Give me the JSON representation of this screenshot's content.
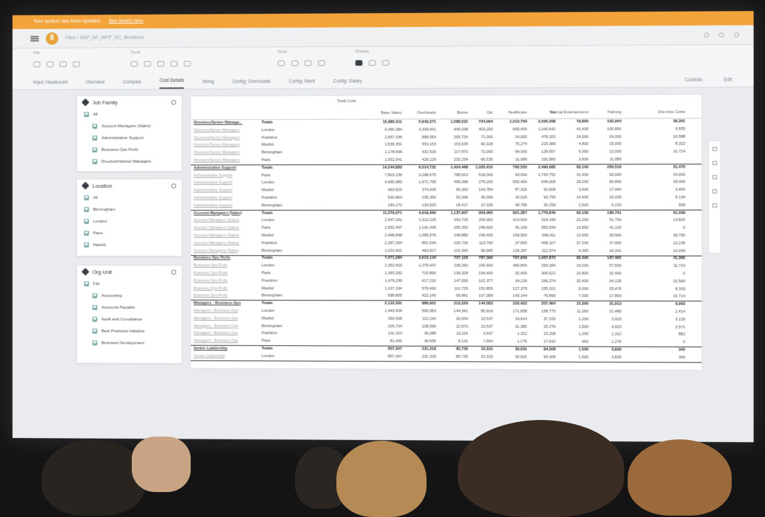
{
  "notice": {
    "text": "Your system has been updated.",
    "link": "See what's new."
  },
  "shell": {
    "logo": "8",
    "breadcrumb": "Files / SAP_SF_WFP_SC_Breakout"
  },
  "toolbar": {
    "file_label": "File",
    "tools_label": "Tools",
    "data_label": "Data",
    "display_label": "Display"
  },
  "tabs": [
    {
      "label": "Input: Headcount"
    },
    {
      "label": "Overview"
    },
    {
      "label": "Compare"
    },
    {
      "label": "Cost Details"
    },
    {
      "label": "Hiring"
    },
    {
      "label": "Config: Overheads"
    },
    {
      "label": "Config: Merit"
    },
    {
      "label": "Config: Salary"
    }
  ],
  "tabs_right": {
    "controls": "Controls",
    "edit": "Edit"
  },
  "filters": {
    "job_family": {
      "title": "Job Family",
      "items": [
        "All",
        "Account Managers (Sales)",
        "Administrative Support",
        "Business Ops Profs",
        "Directors/Senior Managers"
      ]
    },
    "location": {
      "title": "Location",
      "items": [
        "All",
        "Birmingham",
        "London",
        "Paris",
        "Madrid"
      ]
    },
    "org_unit": {
      "title": "Org Unit",
      "items": [
        "F&I",
        "Accounting",
        "Accounts Payable",
        "Audit and Compliance",
        "Best Practices Initiative",
        "Business Development"
      ]
    }
  },
  "grid": {
    "total_cost": "Total Cost",
    "columns": [
      "Base Salary",
      "Overheads",
      "Bonus",
      "Car",
      "Healthcare",
      "Tax",
      "Internal Entertainment",
      "Training",
      "One-time Costs"
    ],
    "rows": [
      {
        "d1": "Directors/Senior Manage...",
        "d2": "Totals",
        "v": [
          "15,885,311",
          "5,643,371",
          "1,588,531",
          "704,064",
          "1,012,764",
          "2,095,268",
          "79,800",
          "162,944",
          "39,391"
        ],
        "t": true
      },
      {
        "d1": "Directors/Senior Managers",
        "d2": "London",
        "v": [
          "9,460,384",
          "3,339,401",
          "946,038",
          "403,200",
          "606,400",
          "1,040,642",
          "42,400",
          "100,800",
          "9,655"
        ]
      },
      {
        "d1": "Directors/Senior Managers",
        "d2": "Frankfurt",
        "v": [
          "2,657,336",
          "888,054",
          "265,734",
          "72,000",
          "24,000",
          "478,320",
          "24,000",
          "24,000",
          "10,588"
        ]
      },
      {
        "d1": "Directors/Senior Managers",
        "d2": "Madrid",
        "v": [
          "1,536,351",
          "554,153",
          "153,635",
          "90,329",
          "75,274",
          "215,089",
          "4,800",
          "15,055",
          "8,322"
        ]
      },
      {
        "d1": "Directors/Senior Managers",
        "d2": "Birmingham",
        "v": [
          "1,178,696",
          "432,526",
          "117,870",
          "72,000",
          "94,000",
          "129,657",
          "5,000",
          "12,000",
          "10,714"
        ]
      },
      {
        "d1": "Directors/Senior Managers",
        "d2": "Paris",
        "v": [
          "1,052,541",
          "429,128",
          "105,254",
          "66,535",
          "11,089",
          "231,560",
          "3,600",
          "11,089",
          ""
        ],
        "e": true
      },
      {
        "d1": "Administrative Support",
        "d2": "Totals",
        "v": [
          "14,244,883",
          "6,014,731",
          "1,424,468",
          "1,020,410",
          "795,535",
          "2,490,682",
          "83,100",
          "200,518",
          "31,470"
        ],
        "t": true
      },
      {
        "d1": "Administrative Support",
        "d2": "Paris",
        "v": [
          "7,803,235",
          "3,298,475",
          "788,523",
          "518,000",
          "93,000",
          "1,734,752",
          "31,400",
          "93,000",
          "24,000"
        ]
      },
      {
        "d1": "Administrative Support",
        "d2": "London",
        "v": [
          "4,990,983",
          "1,971,706",
          "499,098",
          "275,200",
          "550,400",
          "549,008",
          "29,200",
          "66,800",
          "18,000"
        ]
      },
      {
        "d1": "Administrative Support",
        "d2": "Madrid",
        "v": [
          "663,629",
          "374,439",
          "66,363",
          "104,784",
          "87,320",
          "92,908",
          "3,600",
          "17,464",
          "3,400"
        ]
      },
      {
        "d1": "Administrative Support",
        "d2": "Frankfurt",
        "v": [
          "520,664",
          "235,356",
          "52,066",
          "45,066",
          "15,029",
          "93,755",
          "14,400",
          "15,029",
          "5,134"
        ]
      },
      {
        "d1": "Administrative Support",
        "d2": "Birmingham",
        "v": [
          "184,172",
          "134,525",
          "18,417",
          "27,329",
          "49,786",
          "20,259",
          "2,500",
          "6,223",
          "936"
        ],
        "e": true
      },
      {
        "d1": "Account Managers (Sales)",
        "d2": "Totals",
        "v": [
          "11,379,071",
          "4,919,460",
          "1,137,907",
          "903,465",
          "821,387",
          "1,776,840",
          "93,100",
          "186,741",
          "61,099"
        ],
        "t": true
      },
      {
        "d1": "Account Managers (Sales)",
        "d2": "London",
        "v": [
          "2,947,261",
          "1,313,225",
          "294,726",
          "206,000",
          "413,600",
          "324,199",
          "22,200",
          "51,700",
          "14,820"
        ]
      },
      {
        "d1": "Account Managers (Sales)",
        "d2": "Paris",
        "v": [
          "2,652,497",
          "1,191,499",
          "265,250",
          "246,600",
          "41,100",
          "583,549",
          "13,900",
          "41,100",
          "0"
        ]
      },
      {
        "d1": "Account Managers (Sales)",
        "d2": "Madrid",
        "v": [
          "2,468,848",
          "1,089,576",
          "248,885",
          "239,400",
          "199,500",
          "348,411",
          "13,500",
          "39,900",
          "18,750"
        ]
      },
      {
        "d1": "Account Managers (Sales)",
        "d2": "Frankfurt",
        "v": [
          "2,267,264",
          "861,534",
          "226,726",
          "113,700",
          "37,900",
          "408,107",
          "37,200",
          "37,900",
          "13,235"
        ]
      },
      {
        "d1": "Account Managers (Sales)",
        "d2": "Birmingham",
        "v": [
          "1,023,401",
          "463,627",
          "102,340",
          "96,965",
          "129,287",
          "112,574",
          "6,300",
          "16,161",
          "14,294"
        ],
        "e": true
      },
      {
        "d1": "Business Ops Profs",
        "d2": "Totals",
        "v": [
          "7,071,284",
          "3,610,134",
          "707,128",
          "787,390",
          "797,849",
          "1,067,872",
          "82,400",
          "167,495",
          "41,360"
        ],
        "t": true
      },
      {
        "d1": "Business Ops Profs",
        "d2": "London",
        "v": [
          "2,392,603",
          "1,275,447",
          "239,260",
          "230,400",
          "460,800",
          "263,184",
          "24,200",
          "57,600",
          "11,724"
        ]
      },
      {
        "d1": "Business Ops Profs",
        "d2": "Paris",
        "v": [
          "1,393,282",
          "715,850",
          "139,328",
          "194,400",
          "32,400",
          "306,522",
          "10,800",
          "32,400",
          "0"
        ]
      },
      {
        "d1": "Business Ops Profs",
        "d2": "Frankfurt",
        "v": [
          "1,479,299",
          "617,232",
          "147,930",
          "102,377",
          "34,126",
          "266,274",
          "32,400",
          "34,126",
          "10,560"
        ]
      },
      {
        "d1": "Business Ops Profs",
        "d2": "Madrid",
        "v": [
          "1,107,294",
          "579,460",
          "110,729",
          "152,855",
          "127,379",
          "155,021",
          "8,000",
          "25,476",
          "8,333"
        ]
      },
      {
        "d1": "Business Ops Profs",
        "d2": "Birmingham",
        "v": [
          "698,805",
          "422,145",
          "69,881",
          "107,358",
          "143,144",
          "76,869",
          "7,000",
          "17,893",
          "10,714"
        ],
        "e": true
      },
      {
        "d1": "Managers - Business Ops",
        "d2": "Totals",
        "v": [
          "2,122,291",
          "886,931",
          "212,229",
          "144,583",
          "225,422",
          "257,464",
          "15,300",
          "31,913",
          "9,993"
        ],
        "t": true
      },
      {
        "d1": "Managers - Business Ops",
        "d2": "London",
        "v": [
          "1,443,409",
          "595,353",
          "144,341",
          "85,919",
          "171,838",
          "158,775",
          "11,000",
          "21,480",
          "2,414"
        ]
      },
      {
        "d1": "Managers - Business Ops",
        "d2": "Madrid",
        "v": [
          "266,538",
          "112,242",
          "26,654",
          "23,537",
          "19,614",
          "37,315",
          "1,200",
          "3,923",
          "3,125"
        ]
      },
      {
        "d1": "Managers - Business Ops",
        "d2": "Birmingham",
        "v": [
          "229,734",
          "108,596",
          "22,973",
          "23,537",
          "31,382",
          "25,276",
          "1,500",
          "3,923",
          "3,571"
        ]
      },
      {
        "d1": "Managers - Business Ops",
        "d2": "Frankfurt",
        "v": [
          "101,153",
          "36,085",
          "10,115",
          "3,937",
          "1,312",
          "15,208",
          "1,200",
          "1,312",
          "882"
        ]
      },
      {
        "d1": "Managers - Business Ops",
        "d2": "Paris",
        "v": [
          "81,400",
          "36,655",
          "8,141",
          "7,654",
          "1,276",
          "17,910",
          "400",
          "1,276",
          "0"
        ],
        "e": true
      },
      {
        "d1": "Senior Leadership",
        "d2": "Totals",
        "v": [
          "857,347",
          "231,318",
          "85,735",
          "15,315",
          "30,631",
          "94,308",
          "1,500",
          "3,829",
          "345"
        ],
        "t": true
      },
      {
        "d1": "Senior Leadership",
        "d2": "London",
        "v": [
          "857,347",
          "231,318",
          "85,735",
          "15,315",
          "30,631",
          "94,308",
          "1,500",
          "3,829",
          "345"
        ],
        "e": true
      }
    ]
  }
}
